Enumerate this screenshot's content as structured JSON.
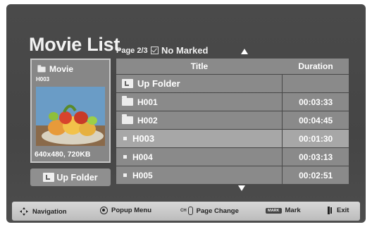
{
  "header": {
    "title": "Movie List",
    "page_info": "Page 2/3",
    "marked_status": "No Marked"
  },
  "preview": {
    "category": "Movie",
    "file": "H003",
    "resolution_size": "640x480, 720KB"
  },
  "up_folder_button": "Up Folder",
  "table": {
    "columns": {
      "title": "Title",
      "duration": "Duration"
    },
    "rows": [
      {
        "title": "Up Folder",
        "duration": "",
        "type": "up"
      },
      {
        "title": "H001",
        "duration": "00:03:33",
        "type": "folder"
      },
      {
        "title": "H002",
        "duration": "00:04:45",
        "type": "folder"
      },
      {
        "title": "H003",
        "duration": "00:01:30",
        "type": "file",
        "selected": true
      },
      {
        "title": "H004",
        "duration": "00:03:13",
        "type": "file"
      },
      {
        "title": "H005",
        "duration": "00:02:51",
        "type": "file"
      }
    ]
  },
  "footer": {
    "navigation": "Navigation",
    "popup_menu": "Popup Menu",
    "ch_label": "CH",
    "page_change": "Page Change",
    "mark_key": "MARK",
    "mark": "Mark",
    "exit": "Exit"
  }
}
